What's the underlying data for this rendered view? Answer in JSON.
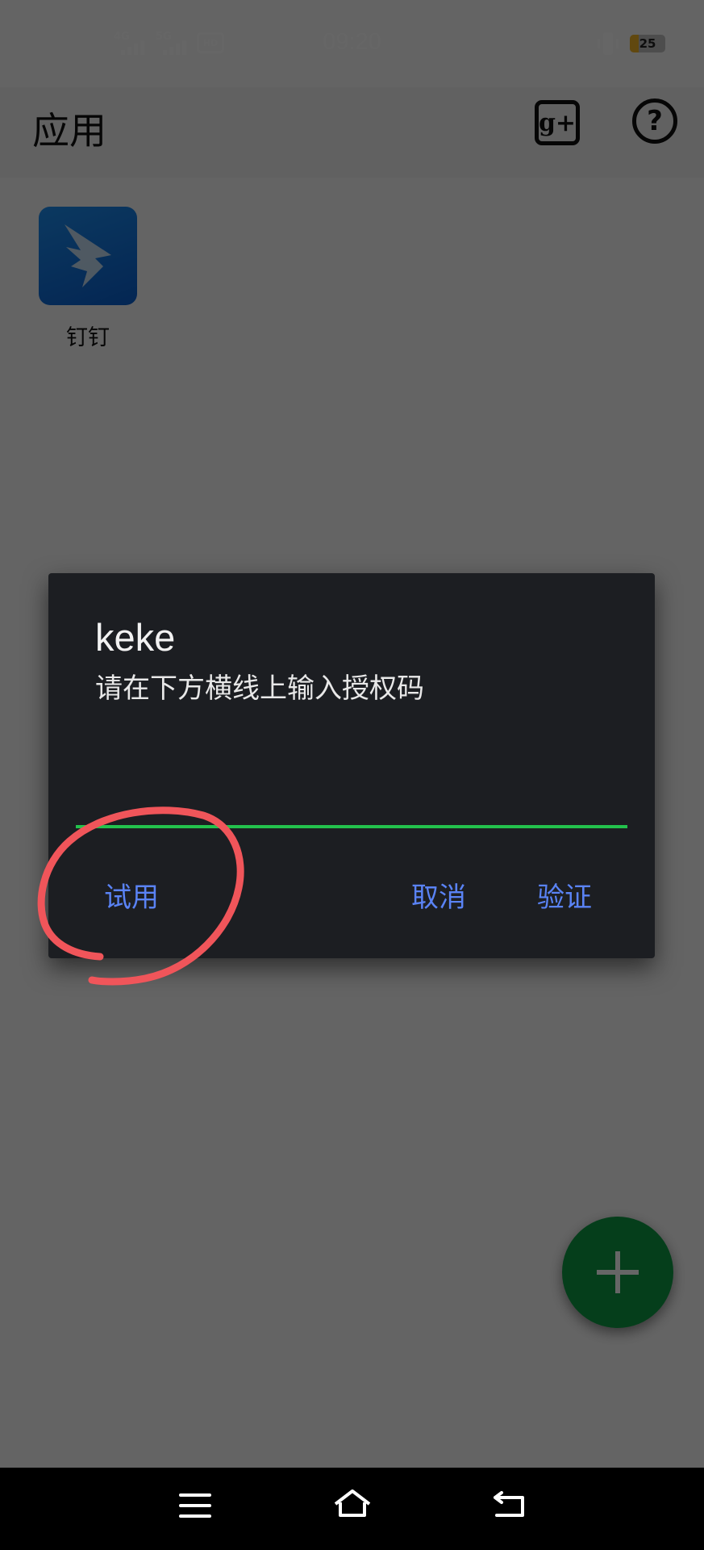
{
  "status_bar": {
    "time": "09:20",
    "signal_1_label": "4G",
    "signal_2_label": "5G",
    "hd_label": "HD",
    "battery_level": "25",
    "battery_color": "#f2b527"
  },
  "app_bar": {
    "title": "应用",
    "gplus_icon": "g+",
    "help_icon": "?"
  },
  "apps": [
    {
      "label": "钉钉",
      "icon": "dingtalk-icon"
    }
  ],
  "dialog": {
    "title": "keke",
    "message": "请在下方横线上输入授权码",
    "input_value": "",
    "trial_label": "试用",
    "cancel_label": "取消",
    "verify_label": "验证",
    "accent_color": "#5a83f5",
    "underline_color": "#23c24d"
  },
  "fab": {
    "icon": "plus-icon",
    "color": "#0e9b45"
  },
  "annotation": {
    "type": "red-circle",
    "color": "#f0555a",
    "target": "试用"
  },
  "nav_bar": {
    "icons": [
      "menu-icon",
      "home-icon",
      "back-icon"
    ]
  }
}
